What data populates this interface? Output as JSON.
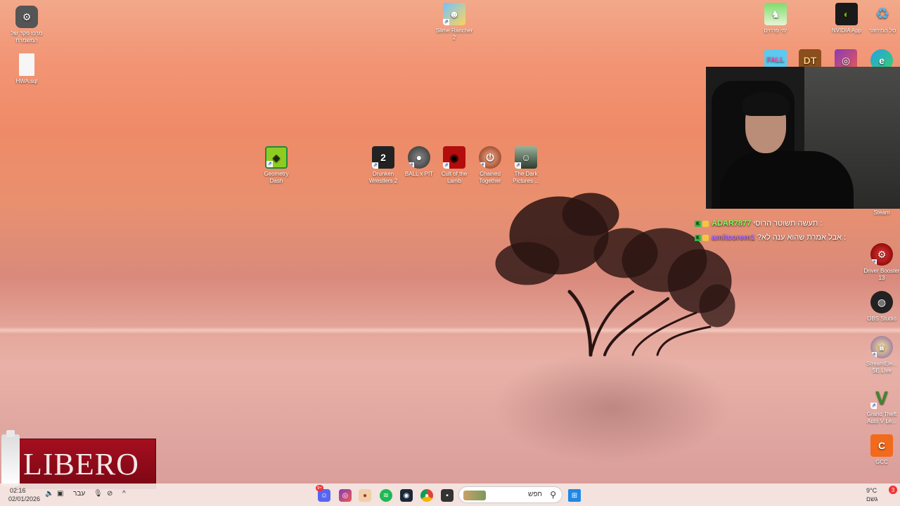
{
  "desktop": {
    "left_icons": [
      {
        "label": "מרכז פקד של המשמרת",
        "icon": "settings-icon"
      },
      {
        "label": "HWA.sql",
        "icon": "file-icon"
      }
    ],
    "top_center_icon": {
      "label": "Slime Rancher 2",
      "icon": "game-icon"
    },
    "center_icons": [
      {
        "label": "Geometry Dash",
        "icon": "geometry-dash-icon"
      },
      {
        "label": "Drunken Wrestlers 2",
        "icon": "drunken-wrestlers-icon"
      },
      {
        "label": "BALL x PIT",
        "icon": "ball-x-pit-icon"
      },
      {
        "label": "Cult of the Lamb",
        "icon": "cult-of-the-lamb-icon"
      },
      {
        "label": "Chained Together",
        "icon": "chained-together-icon"
      },
      {
        "label": "The Dark Pictures ...",
        "icon": "dark-pictures-icon"
      }
    ],
    "top_right_icons": [
      {
        "label": "ימי פרחים",
        "icon": "game-icon"
      },
      {
        "label": "NVIDIA App",
        "icon": "nvidia-icon"
      },
      {
        "label": "סל המיחזור",
        "icon": "recycle-bin-icon"
      }
    ],
    "right_icons": [
      {
        "label": "Steam",
        "icon": "steam-icon"
      },
      {
        "label": "Driver Booster 13",
        "icon": "driver-booster-icon"
      },
      {
        "label": "OBS Studio",
        "icon": "obs-icon"
      },
      {
        "label": "StreamEle... SE.Live",
        "icon": "streamelements-icon"
      },
      {
        "label": "Grand Theft Auto V Le...",
        "icon": "gta-icon"
      },
      {
        "label": "GCC",
        "icon": "gcc-icon"
      }
    ],
    "row2_right_icons": [
      {
        "label": "FALL",
        "icon": "fall-guys-icon"
      },
      {
        "label": "DT",
        "icon": "dt-icon"
      },
      {
        "label": "",
        "icon": "instagram-icon"
      },
      {
        "label": "",
        "icon": "edge-icon"
      }
    ]
  },
  "chat": [
    {
      "user": "ADAR7877",
      "message": "תעשה תשוטר הרוסי :"
    },
    {
      "user": "amitcorem1",
      "message": "?אבל אמרת שהוא ענה לא :"
    }
  ],
  "ad": {
    "brand": "LIBERO"
  },
  "taskbar": {
    "time": "02:16",
    "date": "02/01/2026",
    "language": "עבר",
    "search_placeholder": "חפש",
    "weather_temp": "9°C",
    "weather_label": "גשם",
    "notification_count": "3",
    "discord_badge": "9+"
  },
  "colors": {
    "chat_user1": "#7cff55",
    "chat_user2": "#b070ff",
    "ad_red": "#a50f1f"
  }
}
